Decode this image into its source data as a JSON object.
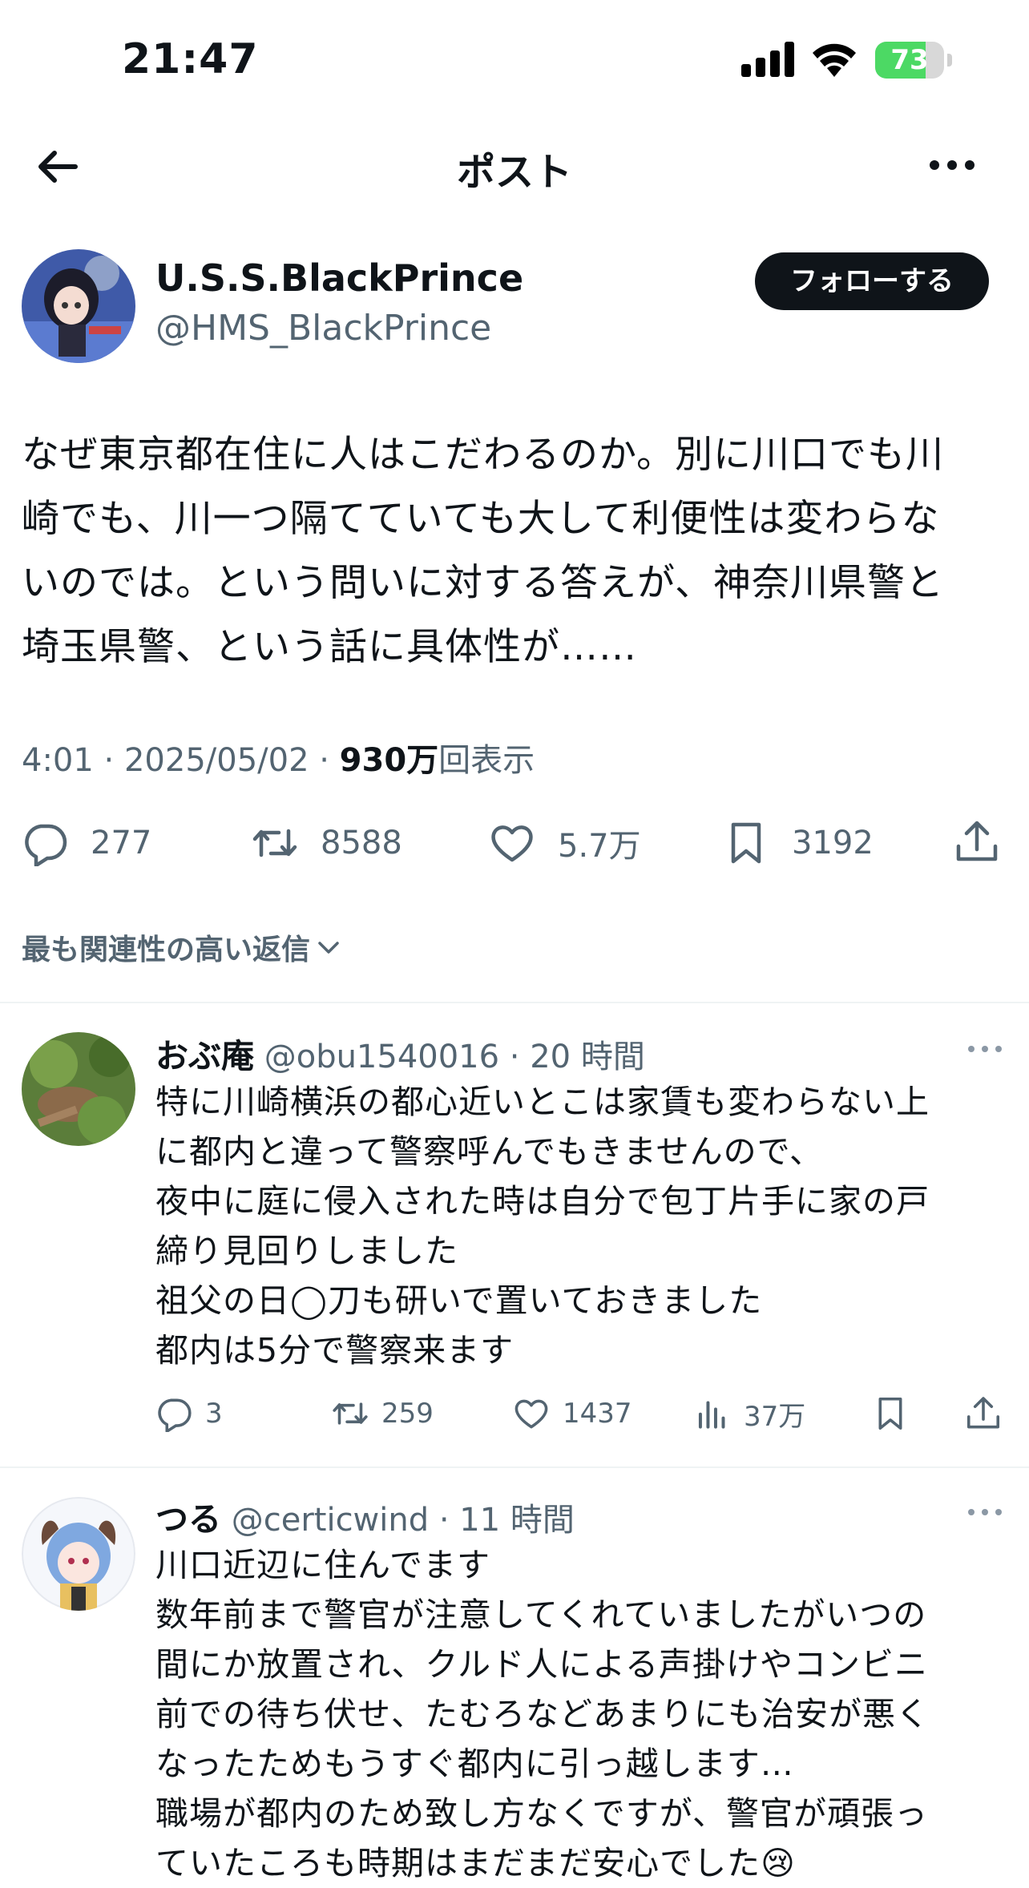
{
  "status_bar": {
    "time": "21:47",
    "battery": "73",
    "battery_level": 0.73
  },
  "header": {
    "title": "ポスト"
  },
  "post": {
    "author_name": "U.S.S.BlackPrince",
    "author_handle": "@HMS_BlackPrince",
    "follow_label": "フォローする",
    "text_lines": [
      "なぜ東京都在住に人はこだわるのか。別に川口でも川",
      "崎でも、川一つ隔てていても大して利便性は変わらな",
      "いのでは。という問いに対する答えが、神奈川県警と",
      "埼玉県警、という話に具体性が……"
    ],
    "timestamp": "4:01 · 2025/05/02 · ",
    "views_count": "930万",
    "views_label": "回表示",
    "replies": "277",
    "reposts": "8588",
    "likes": "5.7万",
    "bookmarks": "3192"
  },
  "sort": {
    "label": "最も関連性の高い返信"
  },
  "replies": [
    {
      "name": "おぶ庵",
      "handle": "@obu1540016",
      "time": "· 20 時間",
      "lines": [
        "特に川崎横浜の都心近いとこは家賃も変わらない上",
        "に都内と違って警察呼んでもきませんので、",
        "夜中に庭に侵入された時は自分で包丁片手に家の戸",
        "締り見回りしました",
        "祖父の日◯刀も研いで置いておきました",
        "都内は5分で警察来ます"
      ],
      "replies": "3",
      "reposts": "259",
      "likes": "1437",
      "views": "37万"
    },
    {
      "name": "つる",
      "handle": "@certicwind",
      "time": "· 11 時間",
      "lines": [
        "川口近辺に住んでます",
        "数年前まで警官が注意してくれていましたがいつの",
        "間にか放置され、クルド人による声掛けやコンビニ",
        "前での待ち伏せ、たむろなどあまりにも治安が悪く",
        "なったためもうすぐ都内に引っ越します…",
        "職場が都内のため致し方なくですが、警官が頑張っ",
        "ていたころも時期はまだまだ安心でした😢"
      ]
    }
  ]
}
